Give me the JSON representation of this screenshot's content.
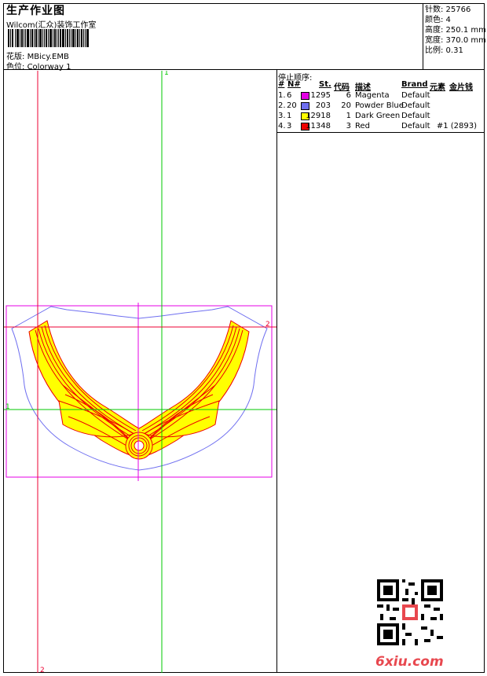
{
  "header": {
    "title": "生产作业图",
    "company": "Wilcom(汇众)装饰工作室",
    "design_label": "花版:",
    "design_value": "MBicy.EMB",
    "colorway_label": "色位:",
    "colorway_value": "Colorway 1"
  },
  "stats": {
    "stitches": "针数: 25766",
    "colors": "颜色: 4",
    "height": "高度: 250.1 mm",
    "width": "宽度: 370.0 mm",
    "scale": "比例: 0.31"
  },
  "stops": {
    "title": "停止顺序:",
    "headers": {
      "num": "#",
      "needle": "N#",
      "stitches": "St.",
      "code": "代码",
      "description": "描述",
      "brand": "Brand",
      "element": "元素",
      "sequin": "金片钱"
    },
    "rows": [
      {
        "num": "1.",
        "needle": "6",
        "color": "#e400e4",
        "stitches": "1295",
        "code": "6",
        "description": "Magenta",
        "brand": "Default",
        "extra": ""
      },
      {
        "num": "2.",
        "needle": "20",
        "color": "#6f6ff0",
        "stitches": "203",
        "code": "20",
        "description": "Powder Blue",
        "brand": "Default",
        "extra": ""
      },
      {
        "num": "3.",
        "needle": "1",
        "color": "#ffff00",
        "stitches": "12918",
        "code": "1",
        "description": "Dark Green",
        "brand": "Default",
        "extra": ""
      },
      {
        "num": "4.",
        "needle": "3",
        "color": "#ee0000",
        "stitches": "11348",
        "code": "3",
        "description": "Red",
        "brand": "Default",
        "extra": "#1 (2893)"
      }
    ]
  },
  "guides": {
    "green_v": "1",
    "green_h": "1",
    "red_v": "2",
    "red_h": "2"
  },
  "colors": {
    "magenta": "#e400e4",
    "outline_blue": "#6f6ff0",
    "fill_yellow": "#ffff00",
    "stitch_red": "#ee0000",
    "guide_green": "#00c800",
    "guide_red": "#ee0033"
  },
  "watermark": "6xiu.com"
}
